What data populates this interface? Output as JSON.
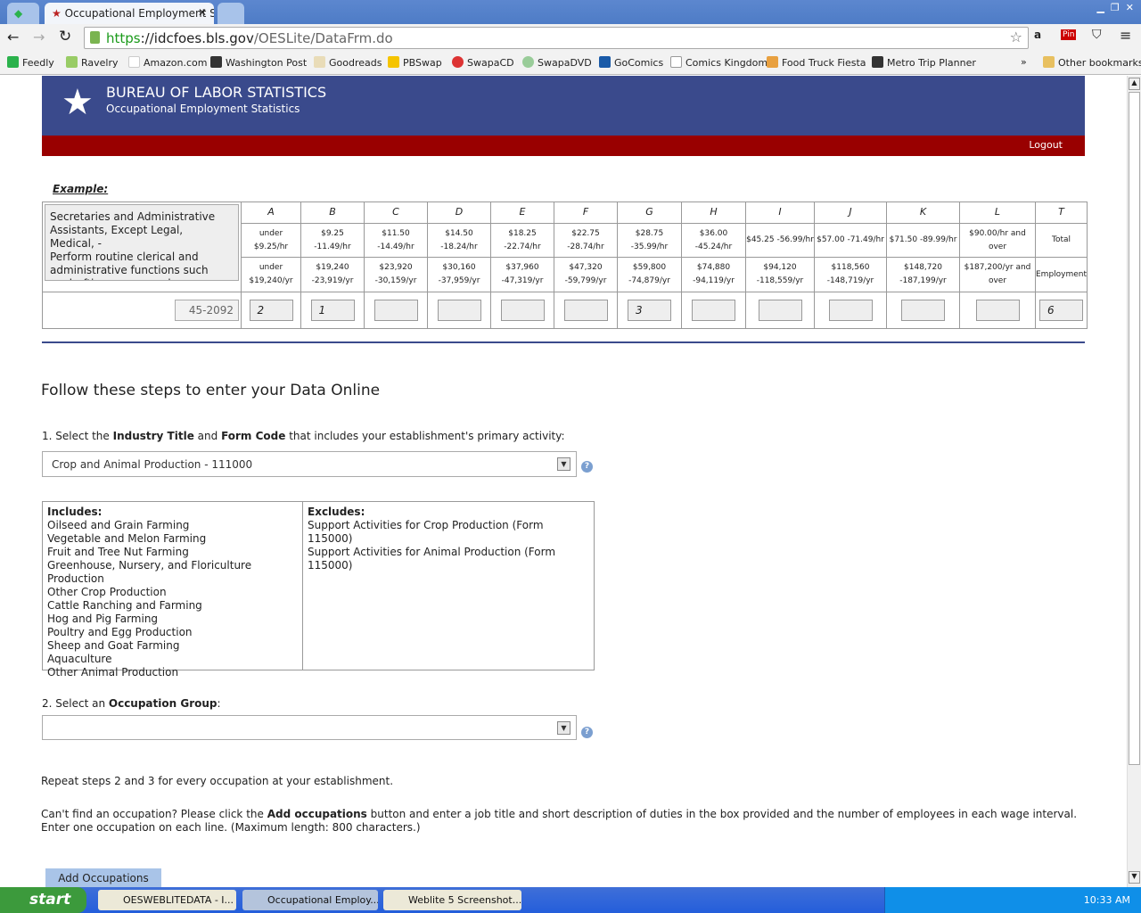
{
  "browser": {
    "tab_title": "Occupational Employment St",
    "url_scheme": "https",
    "url_host": "://idcfoes.bls.gov",
    "url_path": "/OESLite/DataFrm.do",
    "bookmarks": [
      "Feedly",
      "Ravelry",
      "Amazon.com",
      "Washington Post",
      "Goodreads",
      "PBSwap",
      "SwapaCD",
      "SwapaDVD",
      "GoComics",
      "Comics Kingdom",
      "Food Truck Fiesta",
      "Metro Trip Planner"
    ],
    "more": "»",
    "other_bookmarks": "Other bookmarks"
  },
  "header": {
    "title": "BUREAU OF LABOR STATISTICS",
    "subtitle": "Occupational Employment Statistics",
    "logout": "Logout"
  },
  "example": {
    "label": "Example:",
    "occupation_text": "Secretaries and Administrative Assistants, Except Legal, Medical, -\nPerform routine clerical and administrative functions such as drafting correspondence",
    "code": "45-2092",
    "columns": [
      {
        "letter": "A",
        "hourly": [
          "under",
          "$9.25/hr"
        ],
        "annual": [
          "under",
          "$19,240/yr"
        ],
        "value": "2"
      },
      {
        "letter": "B",
        "hourly": [
          "$9.25 -11.49/hr"
        ],
        "annual": [
          "$19,240",
          "-23,919/yr"
        ],
        "value": "1"
      },
      {
        "letter": "C",
        "hourly": [
          "$11.50",
          "-14.49/hr"
        ],
        "annual": [
          "$23,920",
          "-30,159/yr"
        ],
        "value": ""
      },
      {
        "letter": "D",
        "hourly": [
          "$14.50",
          "-18.24/hr"
        ],
        "annual": [
          "$30,160",
          "-37,959/yr"
        ],
        "value": ""
      },
      {
        "letter": "E",
        "hourly": [
          "$18.25",
          "-22.74/hr"
        ],
        "annual": [
          "$37,960",
          "-47,319/yr"
        ],
        "value": ""
      },
      {
        "letter": "F",
        "hourly": [
          "$22.75",
          "-28.74/hr"
        ],
        "annual": [
          "$47,320",
          "-59,799/yr"
        ],
        "value": ""
      },
      {
        "letter": "G",
        "hourly": [
          "$28.75",
          "-35.99/hr"
        ],
        "annual": [
          "$59,800",
          "-74,879/yr"
        ],
        "value": "3"
      },
      {
        "letter": "H",
        "hourly": [
          "$36.00",
          "-45.24/hr"
        ],
        "annual": [
          "$74,880",
          "-94,119/yr"
        ],
        "value": ""
      },
      {
        "letter": "I",
        "hourly": [
          "$45.25 -56.99/hr"
        ],
        "annual": [
          "$94,120",
          "-118,559/yr"
        ],
        "value": ""
      },
      {
        "letter": "J",
        "hourly": [
          "$57.00 -71.49/hr"
        ],
        "annual": [
          "$118,560",
          "-148,719/yr"
        ],
        "value": ""
      },
      {
        "letter": "K",
        "hourly": [
          "$71.50 -89.99/hr"
        ],
        "annual": [
          "$148,720",
          "-187,199/yr"
        ],
        "value": ""
      },
      {
        "letter": "L",
        "hourly": [
          "$90.00/hr and",
          "over"
        ],
        "annual": [
          "$187,200/yr and",
          "over"
        ],
        "value": ""
      },
      {
        "letter": "T",
        "hourly": [
          "Total"
        ],
        "annual": [
          "Employment"
        ],
        "value": "6"
      }
    ]
  },
  "steps": {
    "heading": "Follow these steps to enter your Data Online",
    "step1_pre": "1. Select the ",
    "step1_b1": "Industry Title",
    "step1_mid": " and ",
    "step1_b2": "Form Code",
    "step1_post": " that includes your establishment's primary activity:",
    "industry_value": "Crop and Animal Production - 111000",
    "includes_label": "Includes:",
    "includes": [
      "Oilseed and Grain Farming",
      "Vegetable and Melon Farming",
      "Fruit and Tree Nut Farming",
      "Greenhouse, Nursery, and Floriculture Production",
      "Other Crop Production",
      "Cattle Ranching and Farming",
      "Hog and Pig Farming",
      "Poultry and Egg Production",
      "Sheep and Goat Farming",
      "Aquaculture",
      "Other Animal Production"
    ],
    "excludes_label": "Excludes:",
    "excludes": [
      "Support Activities for Crop Production (Form 115000)",
      "Support Activities for Animal Production (Form 115000)"
    ],
    "step2_pre": "2. Select an ",
    "step2_b": "Occupation Group",
    "step2_post": ":",
    "occupation_value": "",
    "repeat": "Repeat steps 2 and 3 for every occupation at your establishment.",
    "cant_pre": "Can't find an occupation? Please click the ",
    "cant_b": "Add occupations",
    "cant_post": " button and enter a job title and short description of duties in the box provided and the number of employees in each wage interval. Enter one occupation on each line. (Maximum length: 800 characters.)",
    "add_button": "Add Occupations"
  },
  "taskbar": {
    "start": "start",
    "tasks": [
      "OESWEBLITEDATA - I...",
      "Occupational Employ...",
      "Weblite 5 Screenshot..."
    ],
    "clock": "10:33 AM"
  },
  "colors": {
    "banner": "#3a4a8c",
    "redbar": "#990000",
    "button": "#a9c4e8"
  }
}
